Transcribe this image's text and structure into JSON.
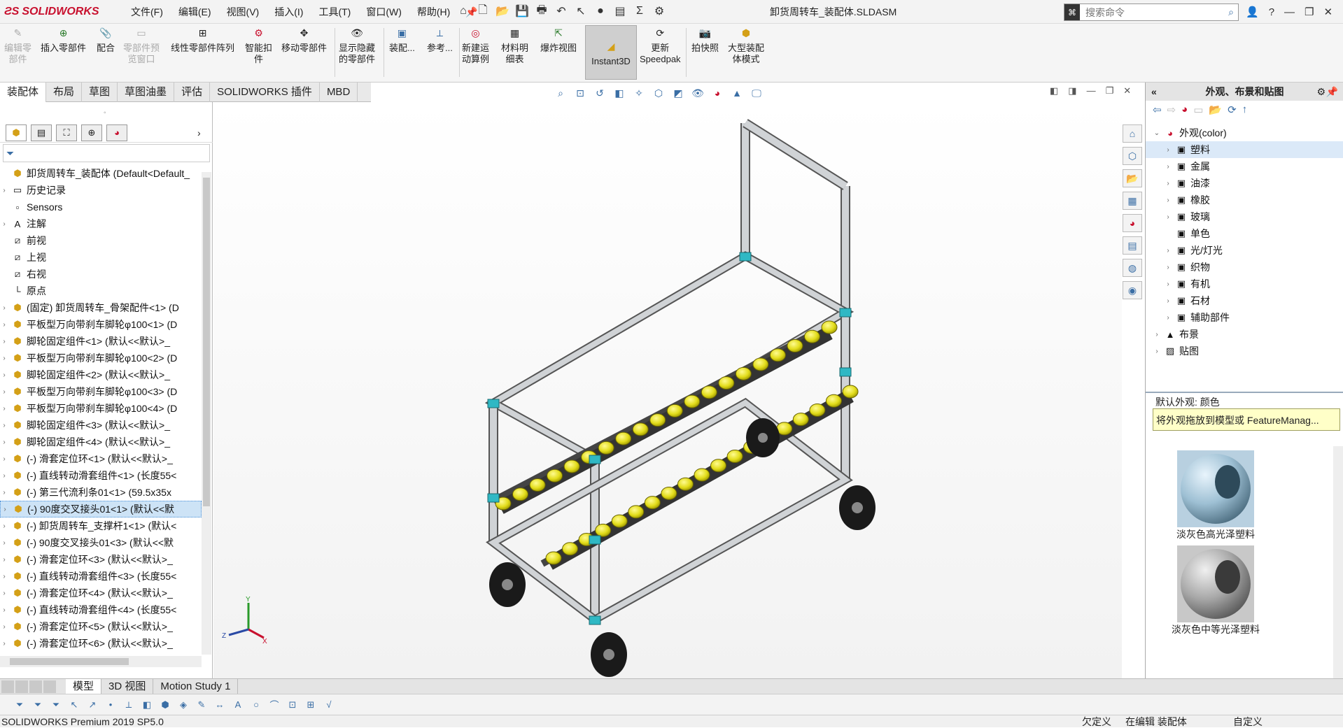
{
  "app": {
    "logo_text": "SOLIDWORKS",
    "doc_title": "卸货周转车_装配体.SLDASM"
  },
  "menu": [
    "文件(F)",
    "编辑(E)",
    "视图(V)",
    "插入(I)",
    "工具(T)",
    "窗口(W)",
    "帮助(H)"
  ],
  "search": {
    "placeholder": "搜索命令"
  },
  "commands": [
    {
      "l1": "编辑零",
      "l2": "部件"
    },
    {
      "l1": "插入零部件",
      "l2": ""
    },
    {
      "l1": "配合",
      "l2": ""
    },
    {
      "l1": "零部件预",
      "l2": "览窗口"
    },
    {
      "l1": "线性零部件阵列",
      "l2": ""
    },
    {
      "l1": "智能扣",
      "l2": "件"
    },
    {
      "l1": "移动零部件",
      "l2": ""
    },
    {
      "l1": "显示隐藏",
      "l2": "的零部件"
    },
    {
      "l1": "装配...",
      "l2": ""
    },
    {
      "l1": "参考...",
      "l2": ""
    },
    {
      "l1": "新建运",
      "l2": "动算例"
    },
    {
      "l1": "材料明",
      "l2": "细表"
    },
    {
      "l1": "爆炸视图",
      "l2": ""
    },
    {
      "l1": "Instant3D",
      "l2": ""
    },
    {
      "l1": "更新",
      "l2": "Speedpak"
    },
    {
      "l1": "拍快照",
      "l2": ""
    },
    {
      "l1": "大型装配",
      "l2": "体模式"
    }
  ],
  "tabs": [
    "装配体",
    "布局",
    "草图",
    "草图油墨",
    "评估",
    "SOLIDWORKS 插件",
    "MBD"
  ],
  "tree": {
    "root": "卸货周转车_装配体 (Default<Default_",
    "items": [
      "历史记录",
      "Sensors",
      "注解",
      "前视",
      "上视",
      "右视",
      "原点",
      "(固定) 卸货周转车_骨架配件<1> (D",
      "平板型万向带刹车脚轮φ100<1> (D",
      "脚轮固定组件<1> (默认<<默认>_",
      "平板型万向带刹车脚轮φ100<2> (D",
      "脚轮固定组件<2> (默认<<默认>_",
      "平板型万向带刹车脚轮φ100<3> (D",
      "平板型万向带刹车脚轮φ100<4> (D",
      "脚轮固定组件<3> (默认<<默认>_",
      "脚轮固定组件<4> (默认<<默认>_",
      "(-) 滑套定位环<1> (默认<<默认>_",
      "(-) 直线转动滑套组件<1> (长度55<",
      "(-) 第三代流利条01<1> (59.5x35x",
      "(-) 90度交叉接头01<1> (默认<<默",
      "(-) 卸货周转车_支撑杆1<1> (默认<",
      "(-) 90度交叉接头01<3> (默认<<默",
      "(-) 滑套定位环<3> (默认<<默认>_",
      "(-) 直线转动滑套组件<3> (长度55<",
      "(-) 滑套定位环<4> (默认<<默认>_",
      "(-) 直线转动滑套组件<4> (长度55<",
      "(-) 滑套定位环<5> (默认<<默认>_",
      "(-) 滑套定位环<6> (默认<<默认>_"
    ]
  },
  "taskpane": {
    "title": "外观、布景和贴图",
    "appearance_root": "外观(color)",
    "appearance_items": [
      "塑料",
      "金属",
      "油漆",
      "橡胶",
      "玻璃",
      "单色",
      "光/灯光",
      "织物",
      "有机",
      "石材",
      "辅助部件"
    ],
    "scene": "布景",
    "decal": "贴图",
    "default_label": "默认外观: 颜色",
    "tooltip": "将外观拖放到模型或 FeatureManag...",
    "swatches": [
      "淡灰色高光泽塑料",
      "淡灰色中等光泽塑料"
    ]
  },
  "bottom_tabs": [
    "模型",
    "3D 视图",
    "Motion Study 1"
  ],
  "status": {
    "product": "SOLIDWORKS Premium 2019 SP5.0",
    "state": "欠定义",
    "editing": "在编辑 装配体",
    "custom": "自定义"
  },
  "colors": {
    "accent": "#3a6ea5",
    "roller": "#e2dc1a",
    "frame": "#b8bcc0",
    "joint": "#2fb8c4",
    "logo": "#c8102e"
  }
}
